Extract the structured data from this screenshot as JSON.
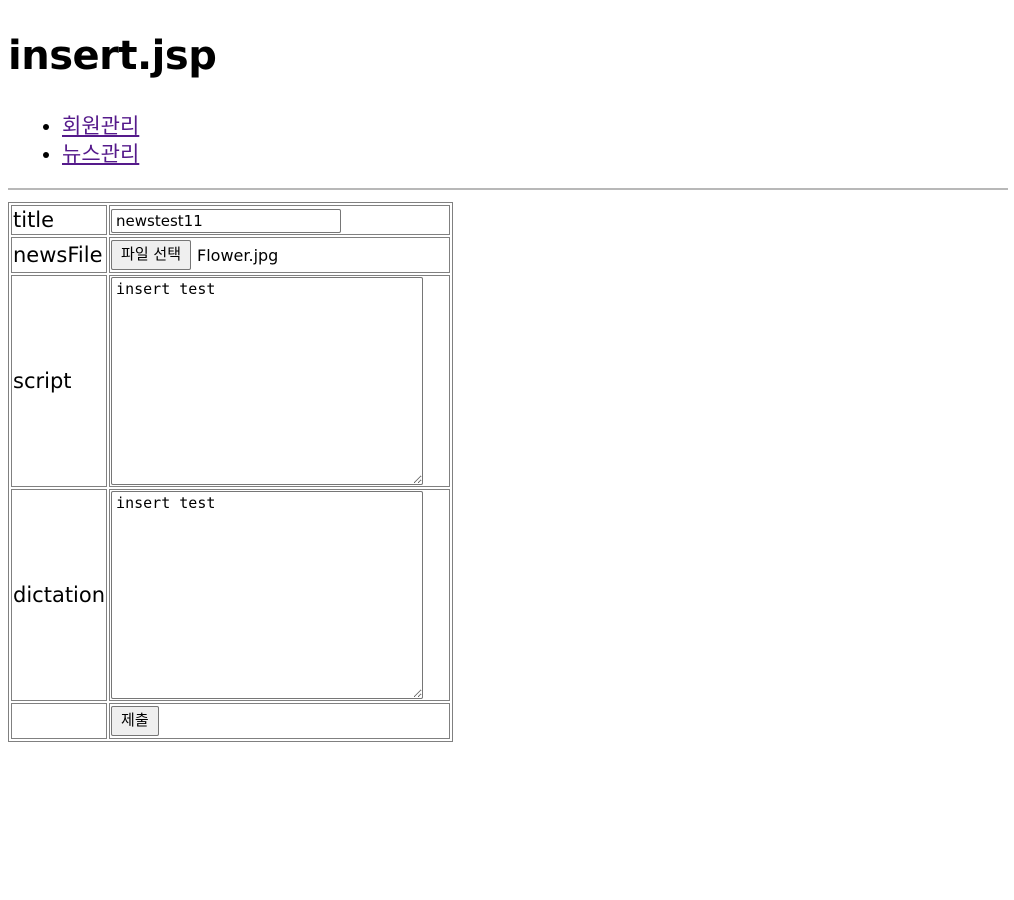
{
  "page": {
    "heading": "insert.jsp"
  },
  "nav": {
    "items": [
      {
        "label": "회원관리"
      },
      {
        "label": "뉴스관리"
      }
    ]
  },
  "form": {
    "title_label": "title",
    "title_value": "newstest11",
    "file_label": "newsFile",
    "file_button": "파일 선택",
    "file_name": "Flower.jpg",
    "script_label": "script",
    "script_value": "insert test",
    "dictation_label": "dictation",
    "dictation_value": "insert test",
    "submit_label": "제출"
  }
}
